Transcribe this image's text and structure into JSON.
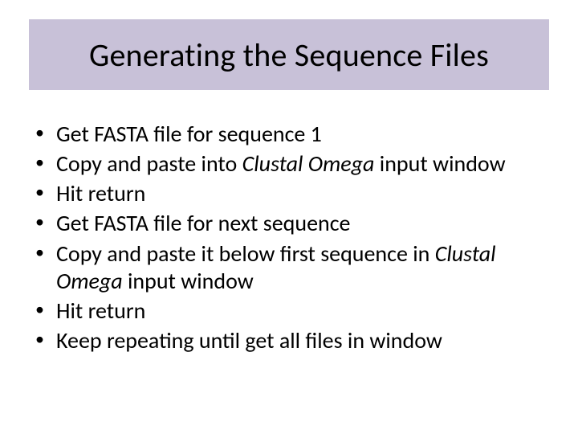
{
  "title": "Generating the Sequence Files",
  "bullets": [
    {
      "pre": "Get FASTA file for sequence 1",
      "em1": "",
      "mid": "",
      "em2": "",
      "post": ""
    },
    {
      "pre": "Copy and paste into ",
      "em1": "Clustal Omega",
      "mid": " input window",
      "em2": "",
      "post": ""
    },
    {
      "pre": "Hit return",
      "em1": "",
      "mid": "",
      "em2": "",
      "post": ""
    },
    {
      "pre": "Get FASTA file for next sequence",
      "em1": "",
      "mid": "",
      "em2": "",
      "post": ""
    },
    {
      "pre": "Copy and paste it below first sequence in ",
      "em1": "Clustal Omega",
      "mid": " input window",
      "em2": "",
      "post": ""
    },
    {
      "pre": "Hit return",
      "em1": "",
      "mid": "",
      "em2": "",
      "post": ""
    },
    {
      "pre": "Keep repeating until get all files in window",
      "em1": "",
      "mid": "",
      "em2": "",
      "post": ""
    }
  ]
}
